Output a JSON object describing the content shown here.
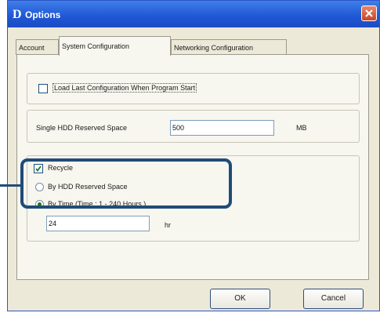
{
  "window": {
    "title": "Options",
    "logo": "D"
  },
  "tabs": [
    {
      "label": "Account",
      "active": false
    },
    {
      "label": "System Configuration",
      "active": true
    },
    {
      "label": "Networking Configuration",
      "active": false
    }
  ],
  "system": {
    "load_last_label": "Load Last Configuration When Program Start",
    "load_last_checked": false,
    "hdd_reserved_label": "Single HDD Reserved Space",
    "hdd_reserved_value": "500",
    "hdd_reserved_unit": "MB",
    "recycle_label": "Recycle",
    "recycle_checked": true,
    "by_hdd_label": "By HDD Reserved Space",
    "by_time_label": "By Time (Time : 1 - 240 Hours )",
    "by_time_value": "24",
    "by_time_unit": "hr"
  },
  "buttons": {
    "ok": "OK",
    "cancel": "Cancel"
  },
  "colors": {
    "title_bar": "#1f56d4",
    "highlight": "#1f4c78"
  }
}
